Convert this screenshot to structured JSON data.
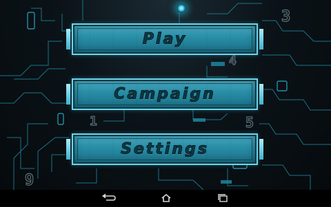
{
  "menu": {
    "play_label": "Play",
    "campaign_label": "Campaign",
    "settings_label": "Settings"
  },
  "background_digits": [
    "3",
    "4",
    "1",
    "5",
    "9"
  ],
  "icons": {
    "back": "back-arrow-icon",
    "home": "home-icon",
    "recents": "recent-apps-icon"
  },
  "colors": {
    "accent": "#2a8fa8",
    "button_border": "#6fd3ea",
    "label": "#0d3a46",
    "circuit": "#1d7f96"
  }
}
